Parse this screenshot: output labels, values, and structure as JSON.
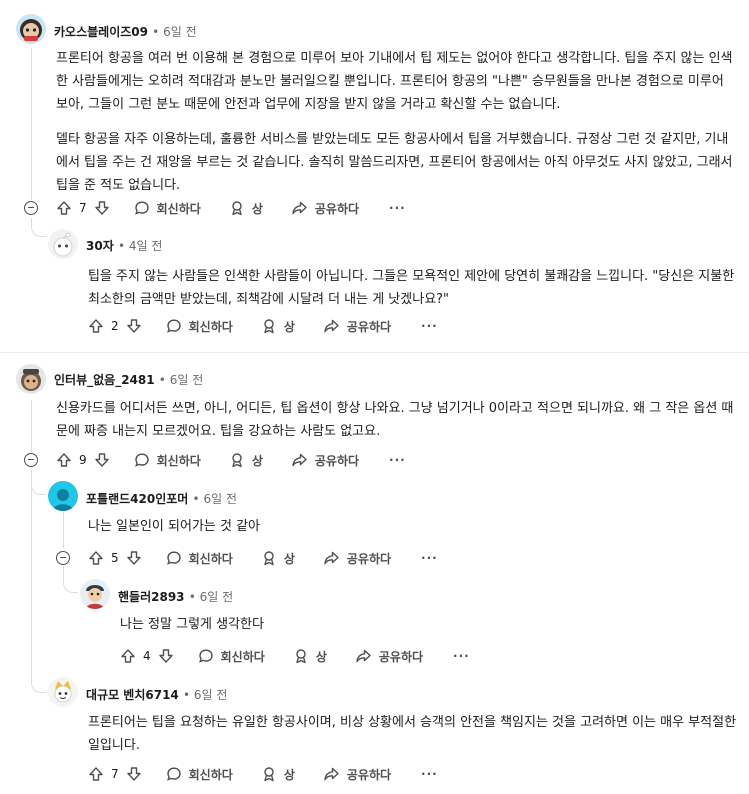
{
  "comments": [
    {
      "username": "카오스블레이즈09",
      "time": "6일 전",
      "body": [
        "프론티어 항공을 여러 번 이용해 본 경험으로 미루어 보아 기내에서 팁 제도는 없어야 한다고 생각합니다. 팁을 주지 않는 인색한 사람들에게는 오히려 적대감과 분노만 불러일으킬 뿐입니다. 프론티어 항공의 \"나쁜\" 승무원들을 만나본 경험으로 미루어 보아, 그들이 그런 분노 때문에 안전과 업무에 지장을 받지 않을 거라고 확신할 수는 없습니다.",
        "델타 항공을 자주 이용하는데, 훌륭한 서비스를 받았는데도 모든 항공사에서 팁을 거부했습니다. 규정상 그런 것 같지만, 기내에서 팁을 주는 건 재앙을 부르는 것 같습니다. 솔직히 말씀드리자면, 프론티어 항공에서는 아직 아무것도 사지 않았고, 그래서 팁을 준 적도 없습니다."
      ],
      "votes": "7",
      "reply": "회신하다",
      "award": "상",
      "share": "공유하다"
    },
    {
      "username": "30자",
      "time": "4일 전",
      "body": [
        "팁을 주지 않는 사람들은 인색한 사람들이 아닙니다. 그들은 모욕적인 제안에 당연히 불쾌감을 느낍니다. \"당신은 지불한 최소한의 금액만 받았는데, 죄책감에 시달려 더 내는 게 낫겠나요?\""
      ],
      "votes": "2",
      "reply": "회신하다",
      "award": "상",
      "share": "공유하다"
    },
    {
      "username": "인터뷰_없음_2481",
      "time": "6일 전",
      "body": [
        "신용카드를 어디서든 쓰면, 아니, 어디든, 팁 옵션이 항상 나와요. 그냥 넘기거나 0이라고 적으면 되니까요. 왜 그 작은 옵션 때문에 짜증 내는지 모르겠어요. 팁을 강요하는 사람도 없고요."
      ],
      "votes": "9",
      "reply": "회신하다",
      "award": "상",
      "share": "공유하다"
    },
    {
      "username": "포틀랜드420인포머",
      "time": "6일 전",
      "body": [
        "나는 일본인이 되어가는 것 같아"
      ],
      "votes": "5",
      "reply": "회신하다",
      "award": "상",
      "share": "공유하다"
    },
    {
      "username": "핸들러2893",
      "time": "6일 전",
      "body": [
        "나는 정말 그렇게 생각한다"
      ],
      "votes": "4",
      "reply": "회신하다",
      "award": "상",
      "share": "공유하다"
    },
    {
      "username": "대규모 벤치6714",
      "time": "6일 전",
      "body": [
        "프론티어는 팁을 요청하는 유일한 항공사이며, 비상 상황에서 승객의 안전을 책임지는 것을 고려하면 이는 매우 부적절한 일입니다."
      ],
      "votes": "7",
      "reply": "회신하다",
      "award": "상",
      "share": "공유하다"
    }
  ],
  "more_label": "···",
  "colors": {
    "text": "#1c1c1c",
    "meta": "#6a6d70",
    "icon": "#4d4f52",
    "thread": "#dcdcdc"
  }
}
